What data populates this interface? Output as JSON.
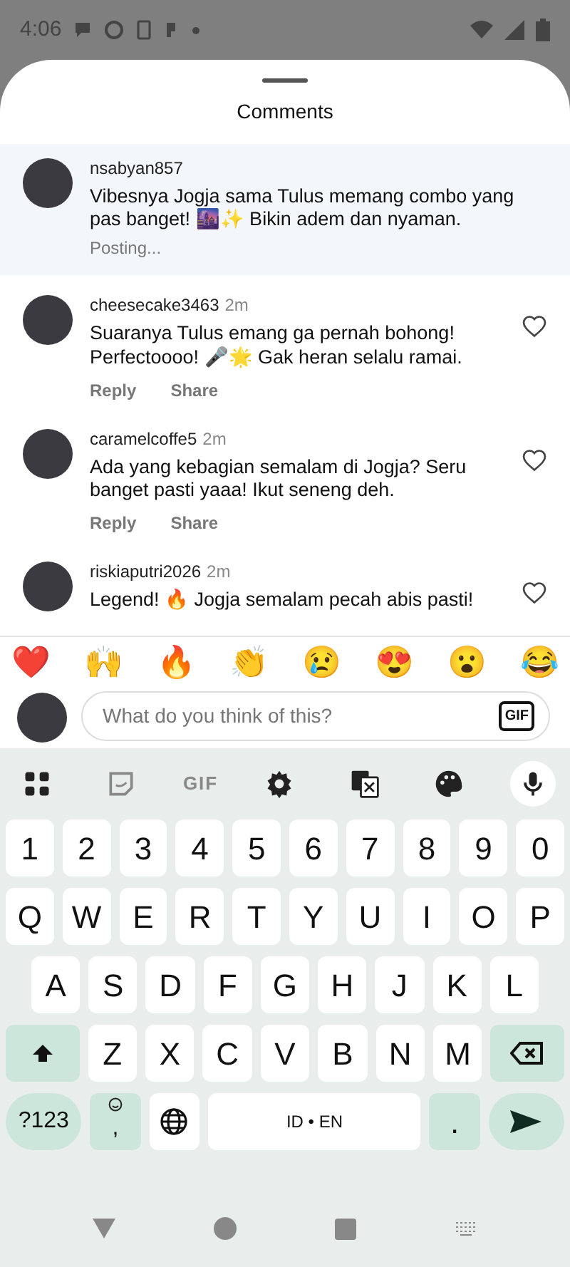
{
  "status_bar": {
    "time": "4:06"
  },
  "sheet": {
    "title": "Comments"
  },
  "comments": [
    {
      "kind": "posting",
      "username": "nsabyan857",
      "text": "Vibesnya Jogja sama Tulus memang combo yang pas banget! 🌆✨ Bikin adem dan nyaman.",
      "status": "Posting..."
    },
    {
      "kind": "posted",
      "username": "cheesecake3463",
      "time": "2m",
      "text": "Suaranya Tulus emang ga pernah bohong! Perfectoooo! 🎤🌟 Gak heran selalu ramai.",
      "actions": [
        "Reply",
        "Share"
      ],
      "liked": false
    },
    {
      "kind": "posted",
      "username": "caramelcoffe5",
      "time": "2m",
      "text": "Ada yang kebagian semalam di Jogja? Seru banget pasti yaaa! Ikut seneng deh.",
      "actions": [
        "Reply",
        "Share"
      ],
      "liked": false
    },
    {
      "kind": "posted",
      "username": "riskiaputri2026",
      "time": "2m",
      "text": "Legend! 🔥 Jogja semalam pecah abis pasti!",
      "liked": false
    }
  ],
  "reactions": [
    "❤️",
    "🙌",
    "🔥",
    "👏",
    "😢",
    "😍",
    "😮",
    "😂"
  ],
  "composer": {
    "placeholder": "What do you think of this?",
    "gif_label": "GIF"
  },
  "keyboard": {
    "toolbar": [
      {
        "kind": "grid"
      },
      {
        "kind": "sticker"
      },
      {
        "kind": "gif",
        "label": "GIF"
      },
      {
        "kind": "settings"
      },
      {
        "kind": "translate"
      },
      {
        "kind": "palette"
      },
      {
        "kind": "mic"
      }
    ],
    "rows": [
      [
        {
          "kind": "char",
          "label": "1"
        },
        {
          "kind": "char",
          "label": "2"
        },
        {
          "kind": "char",
          "label": "3"
        },
        {
          "kind": "char",
          "label": "4"
        },
        {
          "kind": "char",
          "label": "5"
        },
        {
          "kind": "char",
          "label": "6"
        },
        {
          "kind": "char",
          "label": "7"
        },
        {
          "kind": "char",
          "label": "8"
        },
        {
          "kind": "char",
          "label": "9"
        },
        {
          "kind": "char",
          "label": "0"
        }
      ],
      [
        {
          "kind": "char",
          "label": "Q"
        },
        {
          "kind": "char",
          "label": "W"
        },
        {
          "kind": "char",
          "label": "E"
        },
        {
          "kind": "char",
          "label": "R"
        },
        {
          "kind": "char",
          "label": "T"
        },
        {
          "kind": "char",
          "label": "Y"
        },
        {
          "kind": "char",
          "label": "U"
        },
        {
          "kind": "char",
          "label": "I"
        },
        {
          "kind": "char",
          "label": "O"
        },
        {
          "kind": "char",
          "label": "P"
        }
      ],
      [
        {
          "kind": "char",
          "label": "A"
        },
        {
          "kind": "char",
          "label": "S"
        },
        {
          "kind": "char",
          "label": "D"
        },
        {
          "kind": "char",
          "label": "F"
        },
        {
          "kind": "char",
          "label": "G"
        },
        {
          "kind": "char",
          "label": "H"
        },
        {
          "kind": "char",
          "label": "J"
        },
        {
          "kind": "char",
          "label": "K"
        },
        {
          "kind": "char",
          "label": "L"
        }
      ],
      [
        {
          "kind": "shift"
        },
        {
          "kind": "char",
          "label": "Z"
        },
        {
          "kind": "char",
          "label": "X"
        },
        {
          "kind": "char",
          "label": "C"
        },
        {
          "kind": "char",
          "label": "V"
        },
        {
          "kind": "char",
          "label": "B"
        },
        {
          "kind": "char",
          "label": "N"
        },
        {
          "kind": "char",
          "label": "M"
        },
        {
          "kind": "backspace"
        }
      ],
      [
        {
          "kind": "symbols",
          "label": "?123"
        },
        {
          "kind": "emoji",
          "label": ","
        },
        {
          "kind": "globe"
        },
        {
          "kind": "space",
          "label": "ID • EN"
        },
        {
          "kind": "period",
          "label": "."
        },
        {
          "kind": "enter"
        }
      ]
    ]
  }
}
